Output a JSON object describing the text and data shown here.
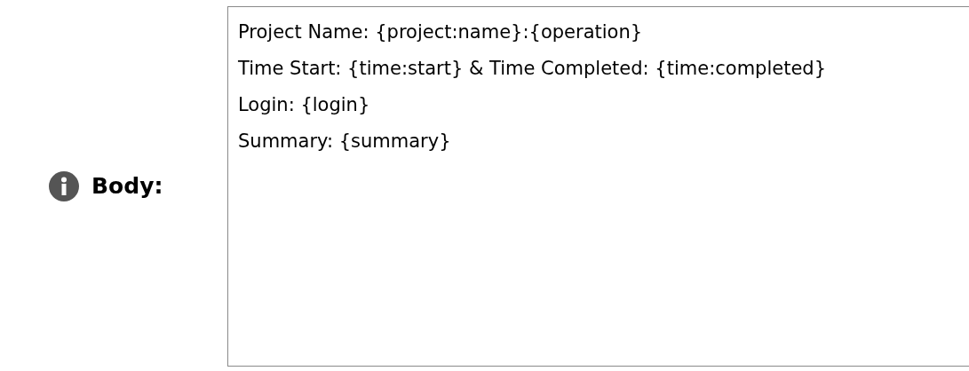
{
  "field": {
    "label": "Body:",
    "value_lines": [
      "Project Name: {project:name}:{operation}",
      "Time Start: {time:start} & Time Completed: {time:completed}",
      "Login: {login}",
      "Summary: {summary}"
    ]
  }
}
